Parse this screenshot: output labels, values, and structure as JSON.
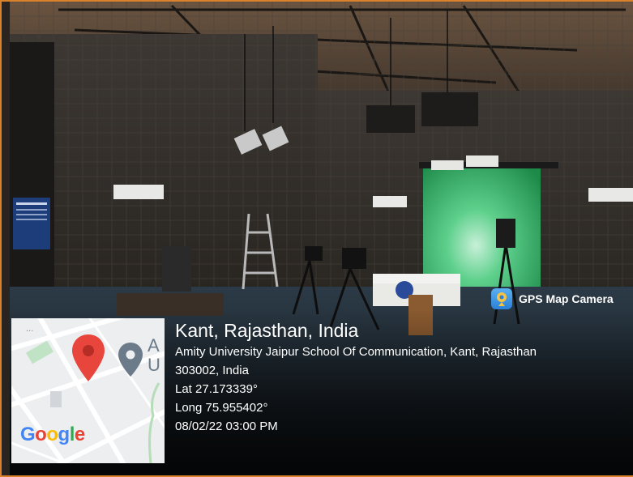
{
  "photo": {
    "description_icon": "studio-photo"
  },
  "map": {
    "logo_letters": [
      "G",
      "o",
      "o",
      "g",
      "l",
      "e"
    ],
    "logo_colors": [
      "#4285f4",
      "#ea4335",
      "#fbbc05",
      "#4285f4",
      "#34a853",
      "#ea4335"
    ],
    "pin_color": "#e8453c",
    "place_pin_color": "#6b7b8a",
    "place_label": "A\nU"
  },
  "location": {
    "title": "Kant, Rajasthan, India",
    "address_line1": "Amity University Jaipur School Of Communication, Kant, Rajasthan",
    "address_line2": "303002, India",
    "lat": "Lat 27.173339°",
    "long": "Long 75.955402°",
    "datetime": "08/02/22 03:00 PM"
  },
  "watermark": {
    "label": "GPS Map Camera",
    "icon": "gps-map-camera-icon"
  },
  "colors": {
    "frame_border": "#d9822b",
    "panel_bg": "#1c1a18"
  }
}
